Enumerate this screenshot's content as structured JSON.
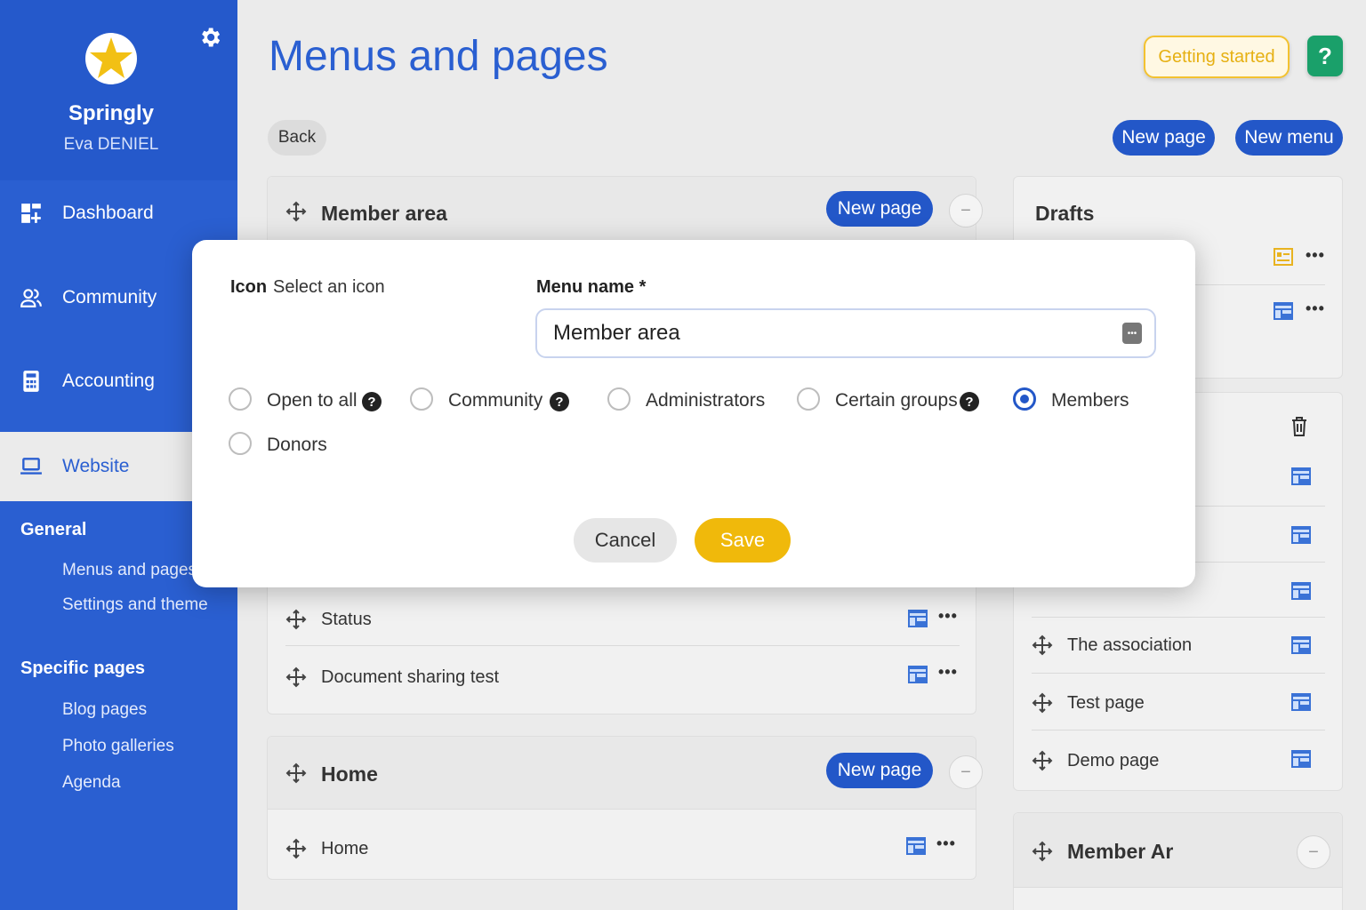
{
  "sidebar": {
    "brand": "Springly",
    "user": "Eva DENIEL",
    "nav": [
      {
        "label": "Dashboard"
      },
      {
        "label": "Community"
      },
      {
        "label": "Accounting"
      },
      {
        "label": "Website"
      }
    ],
    "general_heading": "General",
    "general_links": [
      "Menus and pages",
      "Settings and theme"
    ],
    "specific_heading": "Specific pages",
    "specific_links": [
      "Blog pages",
      "Photo galleries",
      "Agenda"
    ]
  },
  "header": {
    "title": "Menus and pages",
    "getting_started": "Getting started",
    "help": "?",
    "back": "Back",
    "new_page": "New page",
    "new_menu": "New menu"
  },
  "panels": {
    "member_area": {
      "title": "Member area",
      "new_page": "New page",
      "rows": [
        "Status",
        "Document sharing test"
      ]
    },
    "home": {
      "title": "Home",
      "new_page": "New page",
      "rows": [
        "Home"
      ]
    },
    "drafts": {
      "title": "Drafts"
    },
    "right_list": {
      "rows": [
        "The association",
        "Test page",
        "Demo page"
      ]
    },
    "member_ar": {
      "title": "Member Ar"
    }
  },
  "modal": {
    "icon_label": "Icon",
    "icon_action": "Select an icon",
    "menu_name_label": "Menu name *",
    "menu_name_value": "Member area",
    "options": [
      {
        "label": "Open to all",
        "selected": false
      },
      {
        "label": "Community",
        "selected": false
      },
      {
        "label": "Administrators",
        "selected": false
      },
      {
        "label": "Certain groups",
        "selected": false
      },
      {
        "label": "Members",
        "selected": true
      },
      {
        "label": "Donors",
        "selected": false
      }
    ],
    "cancel": "Cancel",
    "save": "Save"
  },
  "colors": {
    "primary": "#2357c8",
    "sidebar": "#2a5fd1",
    "save": "#f0b90b",
    "help": "#1aa06a"
  }
}
